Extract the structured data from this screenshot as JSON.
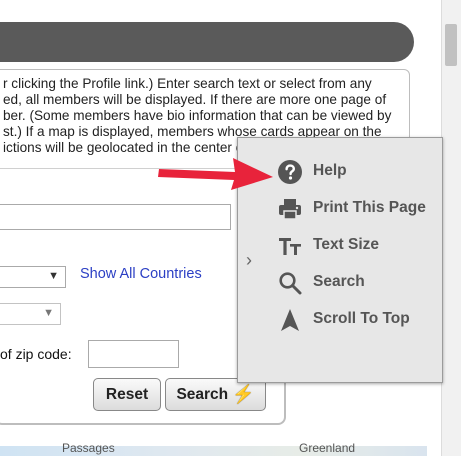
{
  "intro": {
    "lines": [
      "r clicking the Profile link.) Enter search text or select from any",
      "ed, all members will be displayed.  If there are more one page of",
      "ber. (Some members have bio information that can be viewed by",
      "st.) If a map is displayed, members whose cards appear on the",
      "ictions will be geolocated in the center o"
    ]
  },
  "filters": {
    "search_text_value": "",
    "country_select_value": "",
    "state_select_value": "",
    "show_all_countries_link": "Show All Countries",
    "zip_label": "of zip code:",
    "zip_value": "",
    "reset_label": "Reset",
    "search_label": "Search",
    "search_icon": "lightning-bolt-icon"
  },
  "map": {
    "labels": [
      "Passages",
      "Greenland"
    ]
  },
  "menu": {
    "items": [
      {
        "label": "Help",
        "icon": "help-circle-icon"
      },
      {
        "label": "Print This Page",
        "icon": "printer-icon"
      },
      {
        "label": "Text Size",
        "icon": "text-size-icon"
      },
      {
        "label": "Search",
        "icon": "magnifier-icon"
      },
      {
        "label": "Scroll To Top",
        "icon": "navigation-arrow-icon"
      }
    ]
  },
  "colors": {
    "topbar": "#5a5a5a",
    "menu_bg": "#e7e7e7",
    "menu_text": "#555555",
    "link": "#2b3fc4",
    "annotation_arrow": "#e8233b",
    "bolt": "#f2d21b"
  }
}
